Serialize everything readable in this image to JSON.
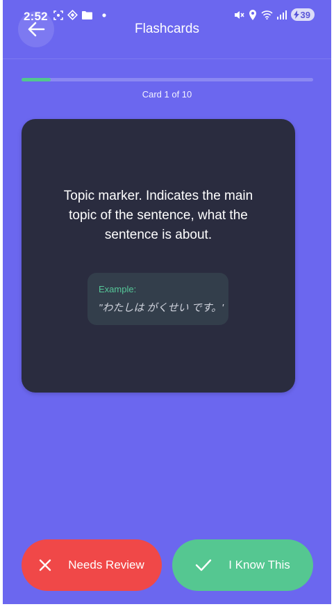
{
  "status_bar": {
    "time": "2:52",
    "battery": "39"
  },
  "header": {
    "title": "Flashcards",
    "back_icon": "arrow-left-icon"
  },
  "progress": {
    "fraction": 0.1,
    "counter_text": "Card 1 of 10",
    "fill_color": "#52c78e"
  },
  "card": {
    "definition": "Topic marker. Indicates the main topic of the sentence, what the sentence is about.",
    "example_label": "Example:",
    "example_text": "\"わたしは がくせい です。'"
  },
  "actions": {
    "review_label": "Needs Review",
    "review_icon": "x-icon",
    "review_color": "#f04848",
    "know_label": "I Know This",
    "know_icon": "check-icon",
    "know_color": "#55c791"
  },
  "colors": {
    "background": "#6b67ef",
    "card": "#2a2c3f"
  }
}
